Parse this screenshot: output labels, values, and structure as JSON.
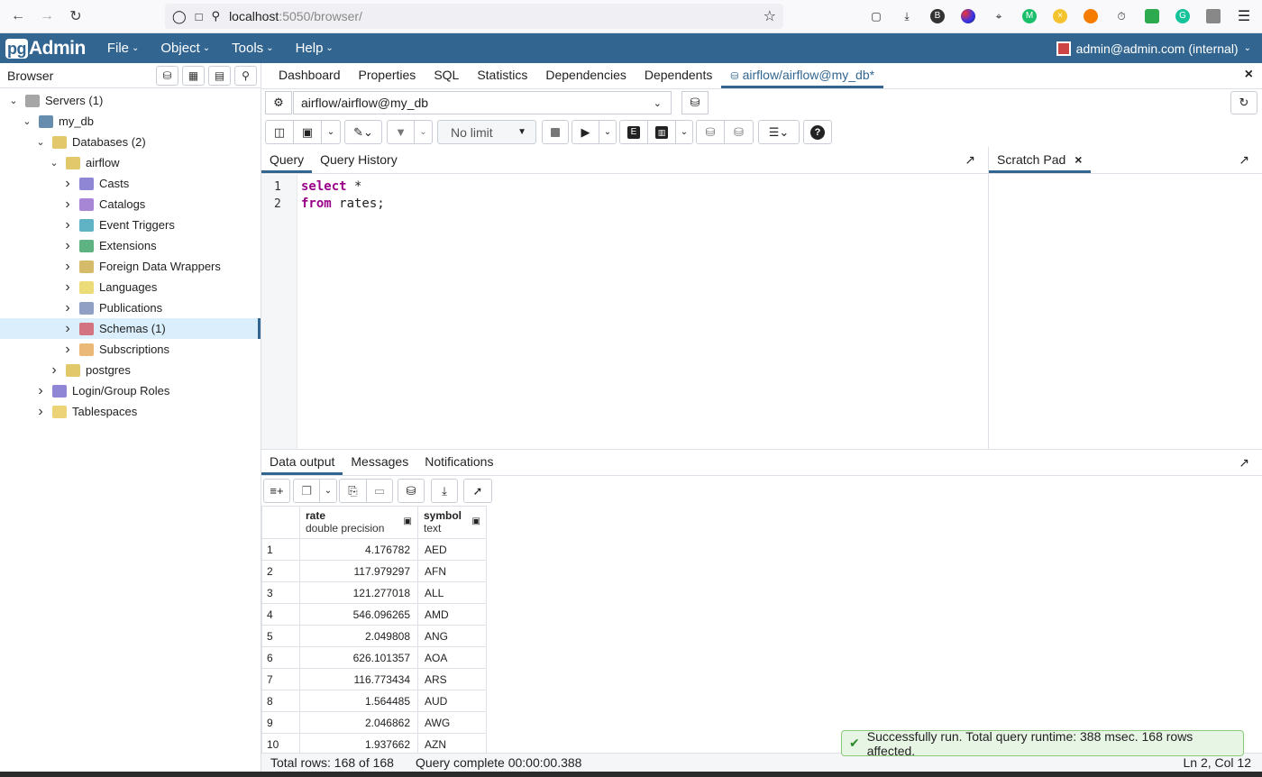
{
  "browser_chrome": {
    "url_host": "localhost",
    "url_path": ":5050/browser/"
  },
  "navbar": {
    "logo_pg": "pg",
    "logo_text": "Admin",
    "menus": [
      "File",
      "Object",
      "Tools",
      "Help"
    ],
    "user": "admin@admin.com (internal)"
  },
  "browser_panel": {
    "title": "Browser",
    "tree": [
      {
        "label": "Servers (1)",
        "level": 0,
        "icon": "servers-icon",
        "expanded": true
      },
      {
        "label": "my_db",
        "level": 1,
        "icon": "elephant-icon",
        "expanded": true
      },
      {
        "label": "Databases (2)",
        "level": 2,
        "icon": "databases-icon",
        "expanded": true
      },
      {
        "label": "airflow",
        "level": 3,
        "icon": "database-icon",
        "expanded": true
      },
      {
        "label": "Casts",
        "level": 4,
        "icon": "casts-icon",
        "expanded": false
      },
      {
        "label": "Catalogs",
        "level": 4,
        "icon": "catalogs-icon",
        "expanded": false
      },
      {
        "label": "Event Triggers",
        "level": 4,
        "icon": "event-triggers-icon",
        "expanded": false
      },
      {
        "label": "Extensions",
        "level": 4,
        "icon": "extensions-icon",
        "expanded": false
      },
      {
        "label": "Foreign Data Wrappers",
        "level": 4,
        "icon": "fdw-icon",
        "expanded": false
      },
      {
        "label": "Languages",
        "level": 4,
        "icon": "languages-icon",
        "expanded": false
      },
      {
        "label": "Publications",
        "level": 4,
        "icon": "publications-icon",
        "expanded": false
      },
      {
        "label": "Schemas (1)",
        "level": 4,
        "icon": "schemas-icon",
        "expanded": false,
        "selected": true
      },
      {
        "label": "Subscriptions",
        "level": 4,
        "icon": "subscriptions-icon",
        "expanded": false
      },
      {
        "label": "postgres",
        "level": 3,
        "icon": "database-icon",
        "expanded": false
      },
      {
        "label": "Login/Group Roles",
        "level": 2,
        "icon": "roles-icon",
        "expanded": false
      },
      {
        "label": "Tablespaces",
        "level": 2,
        "icon": "tablespaces-icon",
        "expanded": false
      }
    ]
  },
  "main_tabs": {
    "items": [
      "Dashboard",
      "Properties",
      "SQL",
      "Statistics",
      "Dependencies",
      "Dependents"
    ],
    "active_tab": "airflow/airflow@my_db*"
  },
  "connection": {
    "selected": "airflow/airflow@my_db"
  },
  "toolbar": {
    "limit": "No limit"
  },
  "query_panel": {
    "tabs": [
      "Query",
      "Query History"
    ],
    "lines": [
      {
        "num": "1",
        "kw": "select",
        "rest": " *"
      },
      {
        "num": "2",
        "kw": "from",
        "rest": " rates;"
      }
    ]
  },
  "scratch_pad": {
    "title": "Scratch Pad"
  },
  "results": {
    "tabs": [
      "Data output",
      "Messages",
      "Notifications"
    ],
    "columns": [
      {
        "name": "rate",
        "type": "double precision"
      },
      {
        "name": "symbol",
        "type": "text"
      }
    ],
    "rows": [
      {
        "n": "1",
        "rate": "4.176782",
        "symbol": "AED"
      },
      {
        "n": "2",
        "rate": "117.979297",
        "symbol": "AFN"
      },
      {
        "n": "3",
        "rate": "121.277018",
        "symbol": "ALL"
      },
      {
        "n": "4",
        "rate": "546.096265",
        "symbol": "AMD"
      },
      {
        "n": "5",
        "rate": "2.049808",
        "symbol": "ANG"
      },
      {
        "n": "6",
        "rate": "626.101357",
        "symbol": "AOA"
      },
      {
        "n": "7",
        "rate": "116.773434",
        "symbol": "ARS"
      },
      {
        "n": "8",
        "rate": "1.564485",
        "symbol": "AUD"
      },
      {
        "n": "9",
        "rate": "2.046862",
        "symbol": "AWG"
      },
      {
        "n": "10",
        "rate": "1.937662",
        "symbol": "AZN"
      }
    ]
  },
  "status": {
    "total_rows": "Total rows: 168 of 168",
    "query_complete": "Query complete 00:00:00.388",
    "cursor": "Ln 2, Col 12"
  },
  "toast": {
    "message": "Successfully run. Total query runtime: 388 msec. 168 rows affected."
  },
  "colors": {
    "brand": "#326690",
    "selection": "#dbeefc",
    "keyword": "#990088",
    "success_bg": "#e7f5e4"
  }
}
